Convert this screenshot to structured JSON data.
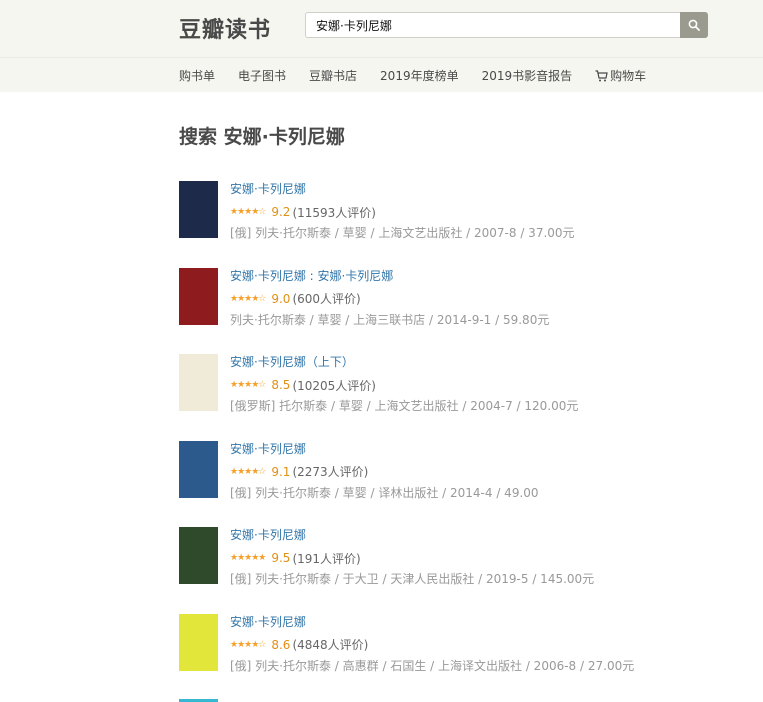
{
  "header": {
    "logo": "豆瓣读书",
    "search_value": "安娜·卡列尼娜"
  },
  "nav": {
    "items": [
      "购书单",
      "电子图书",
      "豆瓣书店",
      "2019年度榜单",
      "2019书影音报告",
      "购物车"
    ]
  },
  "page_title": "搜索 安娜·卡列尼娜",
  "results": [
    {
      "title": "安娜·卡列尼娜",
      "score": "9.2",
      "count": "(11593人评价)",
      "meta": "[俄] 列夫·托尔斯泰 / 草婴 / 上海文艺出版社 / 2007-8 / 37.00元",
      "stars": "4.5",
      "cover_color": "#1e2a4a"
    },
    {
      "title": "安娜·卡列尼娜 : 安娜·卡列尼娜",
      "score": "9.0",
      "count": "(600人评价)",
      "meta": "列夫·托尔斯泰 / 草婴 / 上海三联书店 / 2014-9-1 / 59.80元",
      "stars": "4.5",
      "cover_color": "#8e1b1e"
    },
    {
      "title": "安娜·卡列尼娜（上下）",
      "score": "8.5",
      "count": "(10205人评价)",
      "meta": "[俄罗斯] 托尔斯泰 / 草婴 / 上海文艺出版社 / 2004-7 / 120.00元",
      "stars": "4.5",
      "cover_color": "#efebd8"
    },
    {
      "title": "安娜·卡列尼娜",
      "score": "9.1",
      "count": "(2273人评价)",
      "meta": "[俄] 列夫·托尔斯泰 / 草婴 / 译林出版社 / 2014-4 / 49.00",
      "stars": "4.5",
      "cover_color": "#2c5a8c"
    },
    {
      "title": "安娜·卡列尼娜",
      "score": "9.5",
      "count": "(191人评价)",
      "meta": "[俄] 列夫·托尔斯泰 / 于大卫 / 天津人民出版社 / 2019-5 / 145.00元",
      "stars": "5",
      "cover_color": "#2e4a2a"
    },
    {
      "title": "安娜·卡列尼娜",
      "score": "8.6",
      "count": "(4848人评价)",
      "meta": "[俄] 列夫·托尔斯泰 / 高惠群 / 石国生 / 上海译文出版社 / 2006-8 / 27.00元",
      "stars": "4.5",
      "cover_color": "#e2e63a"
    }
  ],
  "colors": {
    "link": "#3377aa",
    "rating": "#e09015",
    "meta": "#999999",
    "topbar": "#f6f6f1"
  }
}
